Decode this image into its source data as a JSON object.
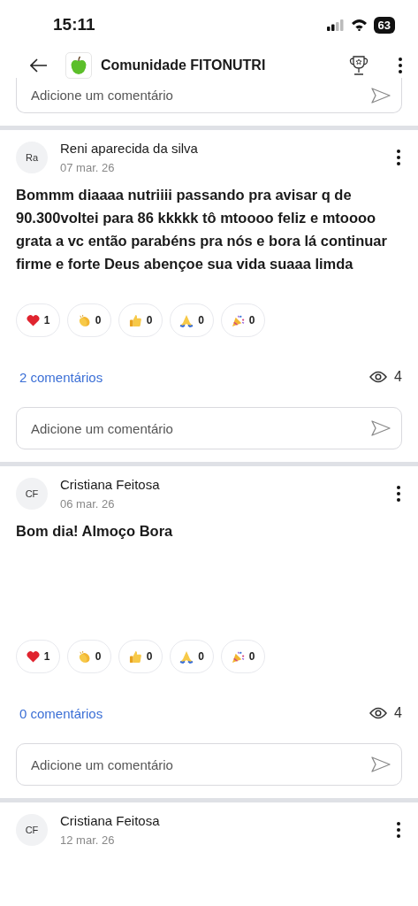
{
  "status_bar": {
    "time": "15:11",
    "battery": "63"
  },
  "header": {
    "title": "Comunidade FITONUTRI"
  },
  "top_comment_field": {
    "placeholder": "Adicione um comentário"
  },
  "posts": [
    {
      "avatar": "Ra",
      "author": "Reni aparecida da silva",
      "date": "07 mar. 26",
      "text": "Bommm diaaaa nutriiii passando pra avisar q de 90.300voltei para 86 kkkkk tô mtoooo feliz e mtoooo grata a vc então parabéns pra nós e bora lá continuar firme e forte Deus abençoe sua vida suaaa limda",
      "reactions": [
        {
          "kind": "heart",
          "count": "1"
        },
        {
          "kind": "clap",
          "count": "0"
        },
        {
          "kind": "thumb",
          "count": "0"
        },
        {
          "kind": "pray",
          "count": "0"
        },
        {
          "kind": "party",
          "count": "0"
        }
      ],
      "comments_link": "2 comentários",
      "views": "4",
      "comment_field": {
        "placeholder": "Adicione um comentário"
      }
    },
    {
      "avatar": "CF",
      "author": "Cristiana Feitosa",
      "date": "06 mar. 26",
      "text": "Bom dia! Almoço Bora",
      "reactions": [
        {
          "kind": "heart",
          "count": "1"
        },
        {
          "kind": "clap",
          "count": "0"
        },
        {
          "kind": "thumb",
          "count": "0"
        },
        {
          "kind": "pray",
          "count": "0"
        },
        {
          "kind": "party",
          "count": "0"
        }
      ],
      "comments_link": "0 comentários",
      "views": "4",
      "comment_field": {
        "placeholder": "Adicione um comentário"
      }
    },
    {
      "avatar": "CF",
      "author": "Cristiana Feitosa",
      "date": "12 mar. 26"
    }
  ]
}
